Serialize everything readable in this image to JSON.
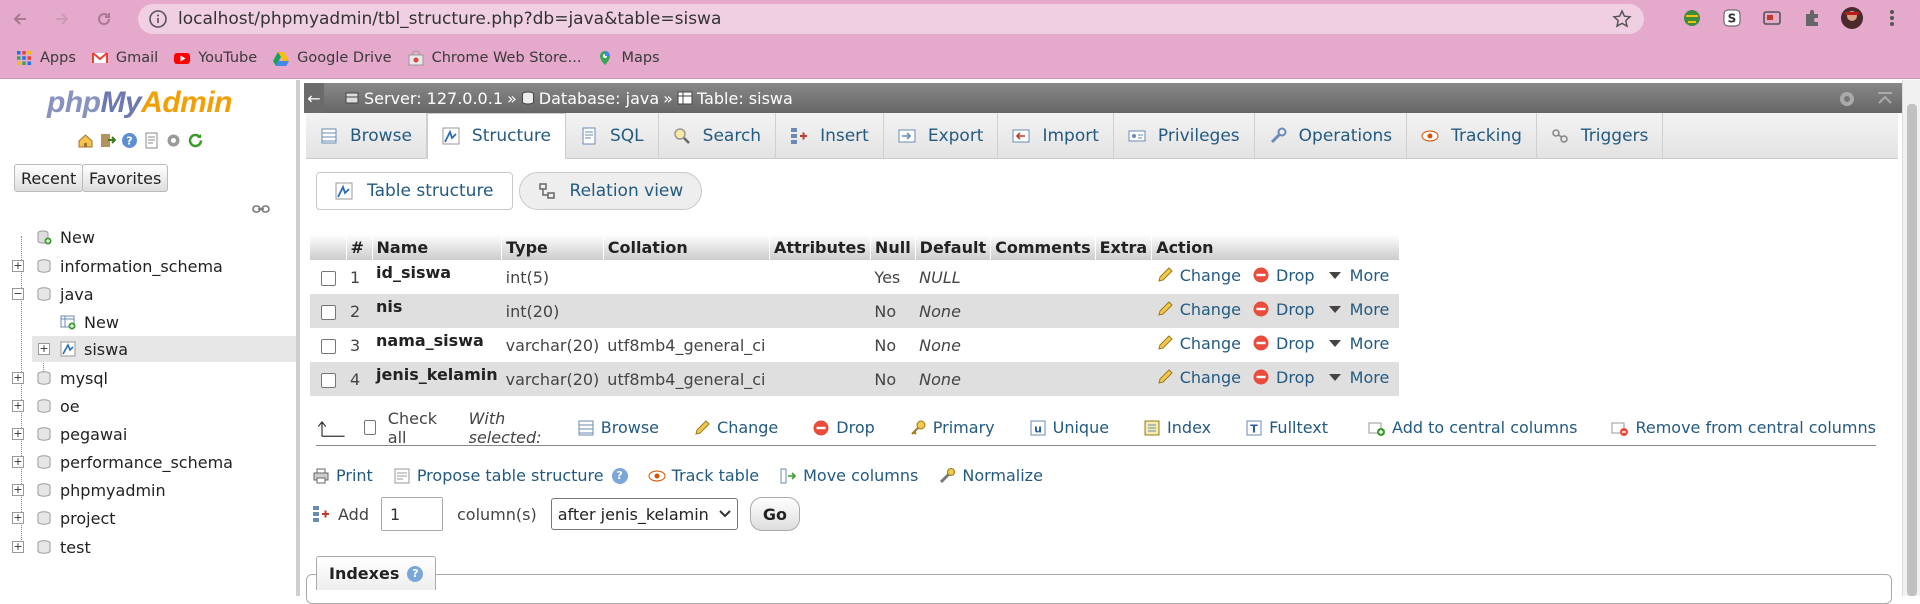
{
  "browser": {
    "url": "localhost/phpmyadmin/tbl_structure.php?db=java&table=siswa",
    "bookmarks": [
      {
        "label": "Apps",
        "icon": "apps-grid-icon"
      },
      {
        "label": "Gmail",
        "icon": "gmail-icon"
      },
      {
        "label": "YouTube",
        "icon": "youtube-icon"
      },
      {
        "label": "Google Drive",
        "icon": "google-drive-icon"
      },
      {
        "label": "Chrome Web Store...",
        "icon": "chrome-web-store-icon"
      },
      {
        "label": "Maps",
        "icon": "maps-icon"
      }
    ],
    "colors": {
      "chrome": "#e4a9cb",
      "omnibox": "#f0cfe2"
    }
  },
  "sidebar": {
    "logo": {
      "php": "php",
      "my": "My",
      "admin": "Admin"
    },
    "recent_label": "Recent",
    "favorites_label": "Favorites",
    "tree": [
      {
        "label": "New",
        "level": 0,
        "expander": "",
        "icon": "new-db-icon"
      },
      {
        "label": "information_schema",
        "level": 0,
        "expander": "+",
        "icon": "database-icon"
      },
      {
        "label": "java",
        "level": 0,
        "expander": "−",
        "icon": "database-icon"
      },
      {
        "label": "New",
        "level": 1,
        "expander": "",
        "icon": "new-table-icon"
      },
      {
        "label": "siswa",
        "level": 1,
        "expander": "+",
        "icon": "table-structure-icon",
        "selected": true
      },
      {
        "label": "mysql",
        "level": 0,
        "expander": "+",
        "icon": "database-icon"
      },
      {
        "label": "oe",
        "level": 0,
        "expander": "+",
        "icon": "database-icon"
      },
      {
        "label": "pegawai",
        "level": 0,
        "expander": "+",
        "icon": "database-icon"
      },
      {
        "label": "performance_schema",
        "level": 0,
        "expander": "+",
        "icon": "database-icon"
      },
      {
        "label": "phpmyadmin",
        "level": 0,
        "expander": "+",
        "icon": "database-icon"
      },
      {
        "label": "project",
        "level": 0,
        "expander": "+",
        "icon": "database-icon"
      },
      {
        "label": "test",
        "level": 0,
        "expander": "+",
        "icon": "database-icon"
      }
    ]
  },
  "breadcrumb": {
    "server": "Server: 127.0.0.1",
    "database": "Database: java",
    "table": "Table: siswa",
    "sep": "»"
  },
  "tabs": [
    {
      "label": "Browse",
      "icon": "browse-icon"
    },
    {
      "label": "Structure",
      "icon": "structure-icon",
      "active": true
    },
    {
      "label": "SQL",
      "icon": "sql-icon"
    },
    {
      "label": "Search",
      "icon": "search-icon"
    },
    {
      "label": "Insert",
      "icon": "insert-icon"
    },
    {
      "label": "Export",
      "icon": "export-icon"
    },
    {
      "label": "Import",
      "icon": "import-icon"
    },
    {
      "label": "Privileges",
      "icon": "privileges-icon"
    },
    {
      "label": "Operations",
      "icon": "operations-icon"
    },
    {
      "label": "Tracking",
      "icon": "tracking-icon"
    },
    {
      "label": "Triggers",
      "icon": "triggers-icon"
    }
  ],
  "subtabs": {
    "table_structure": "Table structure",
    "relation_view": "Relation view"
  },
  "structure_table": {
    "headers": [
      "#",
      "Name",
      "Type",
      "Collation",
      "Attributes",
      "Null",
      "Default",
      "Comments",
      "Extra",
      "Action"
    ],
    "rows": [
      {
        "num": "1",
        "name": "id_siswa",
        "type": "int(5)",
        "collation": "",
        "attributes": "",
        "null": "Yes",
        "default": "NULL",
        "comments": "",
        "extra": ""
      },
      {
        "num": "2",
        "name": "nis",
        "type": "int(20)",
        "collation": "",
        "attributes": "",
        "null": "No",
        "default": "None",
        "comments": "",
        "extra": ""
      },
      {
        "num": "3",
        "name": "nama_siswa",
        "type": "varchar(20)",
        "collation": "utf8mb4_general_ci",
        "attributes": "",
        "null": "No",
        "default": "None",
        "comments": "",
        "extra": ""
      },
      {
        "num": "4",
        "name": "jenis_kelamin",
        "type": "varchar(20)",
        "collation": "utf8mb4_general_ci",
        "attributes": "",
        "null": "No",
        "default": "None",
        "comments": "",
        "extra": ""
      }
    ],
    "actions": {
      "change": "Change",
      "drop": "Drop",
      "more": "More"
    }
  },
  "with_selected": {
    "check_all": "Check all",
    "label": "With selected:",
    "browse": "Browse",
    "change": "Change",
    "drop": "Drop",
    "primary": "Primary",
    "unique": "Unique",
    "index": "Index",
    "fulltext": "Fulltext",
    "add_central": "Add to central columns",
    "remove_central": "Remove from central columns"
  },
  "extra_actions": {
    "print": "Print",
    "propose": "Propose table structure",
    "track": "Track table",
    "move": "Move columns",
    "normalize": "Normalize"
  },
  "add_columns": {
    "add_label": "Add",
    "count": "1",
    "columns_label": "column(s)",
    "position": "after jenis_kelamin",
    "go": "Go"
  },
  "indexes_label": "Indexes"
}
